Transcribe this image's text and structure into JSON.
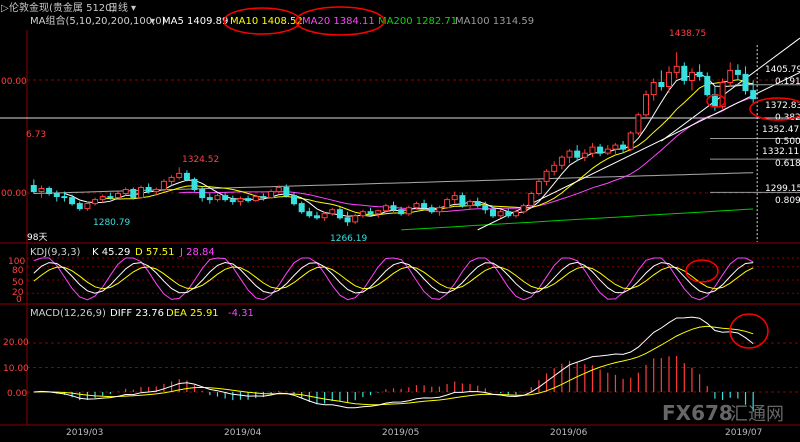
{
  "header": {
    "symbol_text": "伦敦金现(贵金属 5120)",
    "symbol_prefix": "▷",
    "period_text": "日线",
    "period_arrow": "▾"
  },
  "main_panel": {
    "ma_title": "MA组合(5,10,20,200,100,0)",
    "ma_dropdown": "▾",
    "ma5_text": "MA5 1409.89",
    "ma10_text": "MA10 1408.52",
    "ma20_text": "MA20 1384.11",
    "ma200_text": "MA200 1282.71",
    "ma100_text": "MA100 1314.59",
    "y_labels": [
      "00.00",
      "00.00"
    ],
    "peak_labels": {
      "left_edge": "6.73",
      "mar_high": "1324.52",
      "mar_low": "1280.79",
      "may_low": "1266.19",
      "jun_high": "1438.75"
    },
    "days_label": "98天",
    "fib_levels": [
      {
        "price": "1405.79",
        "ratio": "0.191"
      },
      {
        "price": "1372.83",
        "ratio": "0.382"
      },
      {
        "price": "",
        "ratio": "0.500"
      },
      {
        "price": "1352.47",
        "ratio": ""
      },
      {
        "price": "1332.11",
        "ratio": "0.618"
      },
      {
        "price": "1299.15",
        "ratio": "0.809"
      }
    ]
  },
  "kdj_panel": {
    "title": "KDJ(9,3,3)",
    "k_text": "K 45.29",
    "d_text": "D 57.51",
    "j_text": "J 28.84",
    "y_labels": [
      "100",
      "80",
      "50",
      "20",
      "0"
    ]
  },
  "macd_panel": {
    "title": "MACD(12,26,9)",
    "diff_text": "DIFF 23.76",
    "dea_text": "DEA 25.91",
    "macd_text": "-4.31",
    "y_labels": [
      "20.00",
      "10.00",
      "0.00"
    ]
  },
  "x_axis": {
    "labels": [
      "2019/03",
      "2019/04",
      "2019/05",
      "2019/06",
      "2019/07"
    ]
  },
  "watermark": {
    "text": "FX678",
    "cn": "汇通网"
  },
  "colors": {
    "background": "#000000",
    "candle_up": "#ff3b3b",
    "candle_down": "#39e0e0",
    "ma5": "#ffffff",
    "ma10": "#ffff00",
    "ma20": "#ff44ff",
    "ma200": "#00cc00",
    "ma100": "#aaaaaa",
    "kdj_k": "#ffffff",
    "kdj_d": "#ffff00",
    "kdj_j": "#ff44ff",
    "highlight_circle": "#ff0000"
  },
  "chart_data": {
    "type": "candlestick",
    "title": "伦敦金现 日线",
    "xlabel": "",
    "ylabel": "",
    "x_ticks": [
      "2019/03",
      "2019/04",
      "2019/05",
      "2019/06",
      "2019/07"
    ],
    "price_range": [
      1250,
      1460
    ],
    "candles": [
      {
        "o": 1306,
        "h": 1312,
        "l": 1298,
        "c": 1300
      },
      {
        "o": 1300,
        "h": 1306,
        "l": 1294,
        "c": 1303
      },
      {
        "o": 1303,
        "h": 1305,
        "l": 1296,
        "c": 1298
      },
      {
        "o": 1298,
        "h": 1301,
        "l": 1290,
        "c": 1295
      },
      {
        "o": 1295,
        "h": 1300,
        "l": 1290,
        "c": 1294
      },
      {
        "o": 1294,
        "h": 1297,
        "l": 1286,
        "c": 1288
      },
      {
        "o": 1288,
        "h": 1290,
        "l": 1281,
        "c": 1283
      },
      {
        "o": 1283,
        "h": 1290,
        "l": 1281,
        "c": 1288
      },
      {
        "o": 1288,
        "h": 1294,
        "l": 1286,
        "c": 1292
      },
      {
        "o": 1292,
        "h": 1297,
        "l": 1289,
        "c": 1295
      },
      {
        "o": 1295,
        "h": 1299,
        "l": 1292,
        "c": 1294
      },
      {
        "o": 1294,
        "h": 1300,
        "l": 1292,
        "c": 1298
      },
      {
        "o": 1298,
        "h": 1304,
        "l": 1296,
        "c": 1302
      },
      {
        "o": 1302,
        "h": 1304,
        "l": 1292,
        "c": 1294
      },
      {
        "o": 1294,
        "h": 1306,
        "l": 1293,
        "c": 1304
      },
      {
        "o": 1304,
        "h": 1308,
        "l": 1298,
        "c": 1300
      },
      {
        "o": 1300,
        "h": 1304,
        "l": 1296,
        "c": 1302
      },
      {
        "o": 1302,
        "h": 1312,
        "l": 1300,
        "c": 1310
      },
      {
        "o": 1310,
        "h": 1316,
        "l": 1306,
        "c": 1314
      },
      {
        "o": 1314,
        "h": 1324,
        "l": 1312,
        "c": 1318
      },
      {
        "o": 1318,
        "h": 1321,
        "l": 1310,
        "c": 1312
      },
      {
        "o": 1312,
        "h": 1314,
        "l": 1300,
        "c": 1302
      },
      {
        "o": 1302,
        "h": 1305,
        "l": 1290,
        "c": 1294
      },
      {
        "o": 1294,
        "h": 1298,
        "l": 1288,
        "c": 1292
      },
      {
        "o": 1292,
        "h": 1298,
        "l": 1290,
        "c": 1296
      },
      {
        "o": 1296,
        "h": 1299,
        "l": 1290,
        "c": 1292
      },
      {
        "o": 1292,
        "h": 1296,
        "l": 1287,
        "c": 1290
      },
      {
        "o": 1290,
        "h": 1295,
        "l": 1286,
        "c": 1293
      },
      {
        "o": 1293,
        "h": 1296,
        "l": 1289,
        "c": 1291
      },
      {
        "o": 1291,
        "h": 1297,
        "l": 1290,
        "c": 1295
      },
      {
        "o": 1295,
        "h": 1298,
        "l": 1291,
        "c": 1294
      },
      {
        "o": 1294,
        "h": 1302,
        "l": 1293,
        "c": 1300
      },
      {
        "o": 1300,
        "h": 1306,
        "l": 1298,
        "c": 1304
      },
      {
        "o": 1304,
        "h": 1307,
        "l": 1294,
        "c": 1296
      },
      {
        "o": 1296,
        "h": 1299,
        "l": 1286,
        "c": 1288
      },
      {
        "o": 1288,
        "h": 1290,
        "l": 1278,
        "c": 1280
      },
      {
        "o": 1280,
        "h": 1284,
        "l": 1274,
        "c": 1276
      },
      {
        "o": 1276,
        "h": 1280,
        "l": 1272,
        "c": 1274
      },
      {
        "o": 1274,
        "h": 1280,
        "l": 1271,
        "c": 1278
      },
      {
        "o": 1278,
        "h": 1284,
        "l": 1276,
        "c": 1282
      },
      {
        "o": 1282,
        "h": 1285,
        "l": 1272,
        "c": 1274
      },
      {
        "o": 1274,
        "h": 1280,
        "l": 1266,
        "c": 1270
      },
      {
        "o": 1270,
        "h": 1278,
        "l": 1268,
        "c": 1276
      },
      {
        "o": 1276,
        "h": 1282,
        "l": 1274,
        "c": 1280
      },
      {
        "o": 1280,
        "h": 1284,
        "l": 1276,
        "c": 1278
      },
      {
        "o": 1278,
        "h": 1282,
        "l": 1274,
        "c": 1281
      },
      {
        "o": 1281,
        "h": 1288,
        "l": 1279,
        "c": 1286
      },
      {
        "o": 1286,
        "h": 1290,
        "l": 1280,
        "c": 1282
      },
      {
        "o": 1282,
        "h": 1285,
        "l": 1276,
        "c": 1278
      },
      {
        "o": 1278,
        "h": 1286,
        "l": 1276,
        "c": 1284
      },
      {
        "o": 1284,
        "h": 1290,
        "l": 1282,
        "c": 1288
      },
      {
        "o": 1288,
        "h": 1292,
        "l": 1282,
        "c": 1284
      },
      {
        "o": 1284,
        "h": 1287,
        "l": 1278,
        "c": 1280
      },
      {
        "o": 1280,
        "h": 1286,
        "l": 1276,
        "c": 1284
      },
      {
        "o": 1284,
        "h": 1294,
        "l": 1283,
        "c": 1292
      },
      {
        "o": 1292,
        "h": 1300,
        "l": 1288,
        "c": 1296
      },
      {
        "o": 1296,
        "h": 1299,
        "l": 1284,
        "c": 1286
      },
      {
        "o": 1286,
        "h": 1292,
        "l": 1282,
        "c": 1290
      },
      {
        "o": 1290,
        "h": 1294,
        "l": 1284,
        "c": 1286
      },
      {
        "o": 1286,
        "h": 1290,
        "l": 1278,
        "c": 1282
      },
      {
        "o": 1282,
        "h": 1286,
        "l": 1274,
        "c": 1276
      },
      {
        "o": 1276,
        "h": 1282,
        "l": 1274,
        "c": 1280
      },
      {
        "o": 1280,
        "h": 1283,
        "l": 1274,
        "c": 1276
      },
      {
        "o": 1276,
        "h": 1282,
        "l": 1274,
        "c": 1280
      },
      {
        "o": 1280,
        "h": 1288,
        "l": 1278,
        "c": 1286
      },
      {
        "o": 1286,
        "h": 1300,
        "l": 1284,
        "c": 1298
      },
      {
        "o": 1298,
        "h": 1312,
        "l": 1296,
        "c": 1310
      },
      {
        "o": 1310,
        "h": 1322,
        "l": 1306,
        "c": 1320
      },
      {
        "o": 1320,
        "h": 1330,
        "l": 1316,
        "c": 1326
      },
      {
        "o": 1326,
        "h": 1336,
        "l": 1322,
        "c": 1334
      },
      {
        "o": 1334,
        "h": 1342,
        "l": 1328,
        "c": 1340
      },
      {
        "o": 1340,
        "h": 1346,
        "l": 1330,
        "c": 1334
      },
      {
        "o": 1334,
        "h": 1342,
        "l": 1330,
        "c": 1338
      },
      {
        "o": 1338,
        "h": 1348,
        "l": 1334,
        "c": 1344
      },
      {
        "o": 1344,
        "h": 1347,
        "l": 1335,
        "c": 1338
      },
      {
        "o": 1338,
        "h": 1346,
        "l": 1336,
        "c": 1342
      },
      {
        "o": 1342,
        "h": 1348,
        "l": 1336,
        "c": 1346
      },
      {
        "o": 1346,
        "h": 1350,
        "l": 1338,
        "c": 1342
      },
      {
        "o": 1342,
        "h": 1360,
        "l": 1340,
        "c": 1358
      },
      {
        "o": 1358,
        "h": 1378,
        "l": 1356,
        "c": 1376
      },
      {
        "o": 1376,
        "h": 1400,
        "l": 1374,
        "c": 1396
      },
      {
        "o": 1396,
        "h": 1412,
        "l": 1390,
        "c": 1408
      },
      {
        "o": 1408,
        "h": 1420,
        "l": 1400,
        "c": 1404
      },
      {
        "o": 1404,
        "h": 1424,
        "l": 1398,
        "c": 1418
      },
      {
        "o": 1418,
        "h": 1438,
        "l": 1412,
        "c": 1424
      },
      {
        "o": 1424,
        "h": 1428,
        "l": 1406,
        "c": 1410
      },
      {
        "o": 1410,
        "h": 1422,
        "l": 1400,
        "c": 1418
      },
      {
        "o": 1418,
        "h": 1426,
        "l": 1410,
        "c": 1414
      },
      {
        "o": 1414,
        "h": 1418,
        "l": 1394,
        "c": 1396
      },
      {
        "o": 1396,
        "h": 1404,
        "l": 1380,
        "c": 1384
      },
      {
        "o": 1384,
        "h": 1412,
        "l": 1382,
        "c": 1408
      },
      {
        "o": 1408,
        "h": 1428,
        "l": 1404,
        "c": 1420
      },
      {
        "o": 1420,
        "h": 1426,
        "l": 1410,
        "c": 1416
      },
      {
        "o": 1416,
        "h": 1424,
        "l": 1396,
        "c": 1400
      },
      {
        "o": 1400,
        "h": 1410,
        "l": 1388,
        "c": 1392
      }
    ]
  }
}
